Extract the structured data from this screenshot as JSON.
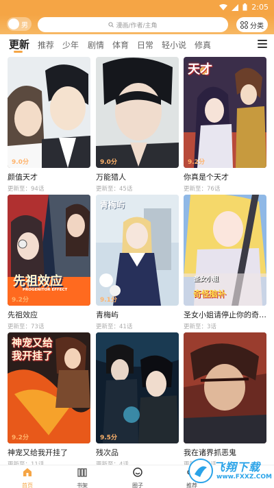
{
  "status_bar": {
    "time": "2:05"
  },
  "header": {
    "gender_label": "男",
    "search_placeholder": "漫画/作者/主角",
    "category_label": "分类"
  },
  "tabs": [
    {
      "label": "更新",
      "active": true
    },
    {
      "label": "推荐"
    },
    {
      "label": "少年"
    },
    {
      "label": "剧情"
    },
    {
      "label": "体育"
    },
    {
      "label": "日常"
    },
    {
      "label": "轻小说"
    },
    {
      "label": "修真"
    }
  ],
  "comics": [
    {
      "title": "颜值天才",
      "update": "更新至：94话",
      "score": "9.0分"
    },
    {
      "title": "万能猎人",
      "update": "更新至：45话",
      "score": "9.0分"
    },
    {
      "title": "你真是个天才",
      "update": "更新至：76话",
      "score": "9.2分",
      "cover_text": "天才"
    },
    {
      "title": "先祖效应",
      "update": "更新至：73话",
      "score": "9.2分",
      "cover_text": "先祖效应",
      "cover_subtext": "PROGENITOR EFFECT"
    },
    {
      "title": "青梅屿",
      "update": "更新至：41话",
      "score": "9.1分",
      "cover_text": "青梅屿"
    },
    {
      "title": "圣女小姐请停止你的奇怪脑补",
      "update": "更新至：3话",
      "score": "",
      "cover_text": "圣女小姐",
      "cover_subtext": "奇怪脑补"
    },
    {
      "title": "神宠又给我开挂了",
      "update": "更新至：11话",
      "score": "9.2分",
      "cover_text": "神宠又给我开挂了"
    },
    {
      "title": "残次品",
      "update": "更新至：4话",
      "score": "9.5分"
    },
    {
      "title": "我在诸界抓恶鬼",
      "update": "更新至：5话",
      "score": ""
    }
  ],
  "bottom_nav": [
    {
      "label": "首页",
      "icon": "home-icon",
      "active": true
    },
    {
      "label": "书架",
      "icon": "bookshelf-icon"
    },
    {
      "label": "圈子",
      "icon": "circle-icon"
    },
    {
      "label": "推荐",
      "icon": "recommend-icon"
    }
  ],
  "watermark": {
    "text": "飞翔下载",
    "url_text": "www.FXXZ.COM"
  },
  "colors": {
    "accent": "#f5a545",
    "watermark": "#2aa3e8"
  }
}
